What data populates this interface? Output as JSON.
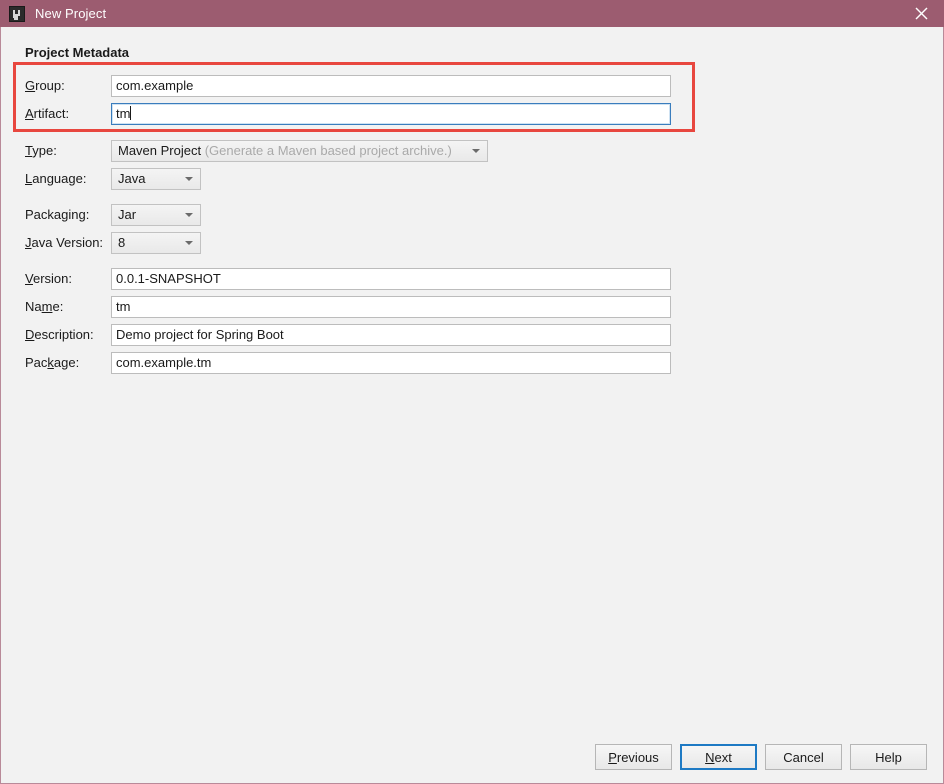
{
  "window": {
    "title": "New Project",
    "icon": "intellij-idea-icon",
    "close_label": "✕",
    "titlebar_color": "#9c5c70",
    "background_color": "#f2f2f2"
  },
  "annotation": {
    "highlight_color": "#e8473f",
    "highlights": [
      "group-row",
      "artifact-row"
    ]
  },
  "form": {
    "section_title": "Project Metadata",
    "rows": [
      {
        "name": "group",
        "label": "Group:",
        "mnemonic": "G",
        "control": "text",
        "value": "com.example",
        "focused": false
      },
      {
        "name": "artifact",
        "label": "Artifact:",
        "mnemonic": "A",
        "control": "text",
        "value": "tm",
        "focused": true
      },
      {
        "name": "type",
        "label": "Type:",
        "mnemonic": "T",
        "control": "combo",
        "value": "Maven Project",
        "hint": "(Generate a Maven based project archive.)",
        "focused": false
      },
      {
        "name": "language",
        "label": "Language:",
        "mnemonic": "L",
        "control": "combo-small",
        "value": "Java",
        "focused": false
      },
      {
        "name": "packaging",
        "label": "Packaging:",
        "mnemonic": "g",
        "control": "combo-small",
        "value": "Jar",
        "focused": false
      },
      {
        "name": "java-version",
        "label": "Java Version:",
        "mnemonic": "J",
        "control": "combo-small",
        "value": "8",
        "focused": false
      },
      {
        "name": "version",
        "label": "Version:",
        "mnemonic": "V",
        "control": "text",
        "value": "0.0.1-SNAPSHOT",
        "focused": false
      },
      {
        "name": "project-name",
        "label": "Name:",
        "mnemonic": "m",
        "control": "text",
        "value": "tm",
        "focused": false
      },
      {
        "name": "description",
        "label": "Description:",
        "mnemonic": "D",
        "control": "text",
        "value": "Demo project for Spring Boot",
        "focused": false
      },
      {
        "name": "package",
        "label": "Package:",
        "mnemonic": "k",
        "control": "text",
        "value": "com.example.tm",
        "focused": false
      }
    ]
  },
  "footer": {
    "buttons": [
      {
        "name": "previous",
        "label": "Previous",
        "mnemonic": "P",
        "default": false
      },
      {
        "name": "next",
        "label": "Next",
        "mnemonic": "N",
        "default": true
      },
      {
        "name": "cancel",
        "label": "Cancel",
        "mnemonic": "",
        "default": false
      },
      {
        "name": "help",
        "label": "Help",
        "mnemonic": "",
        "default": false
      }
    ]
  }
}
